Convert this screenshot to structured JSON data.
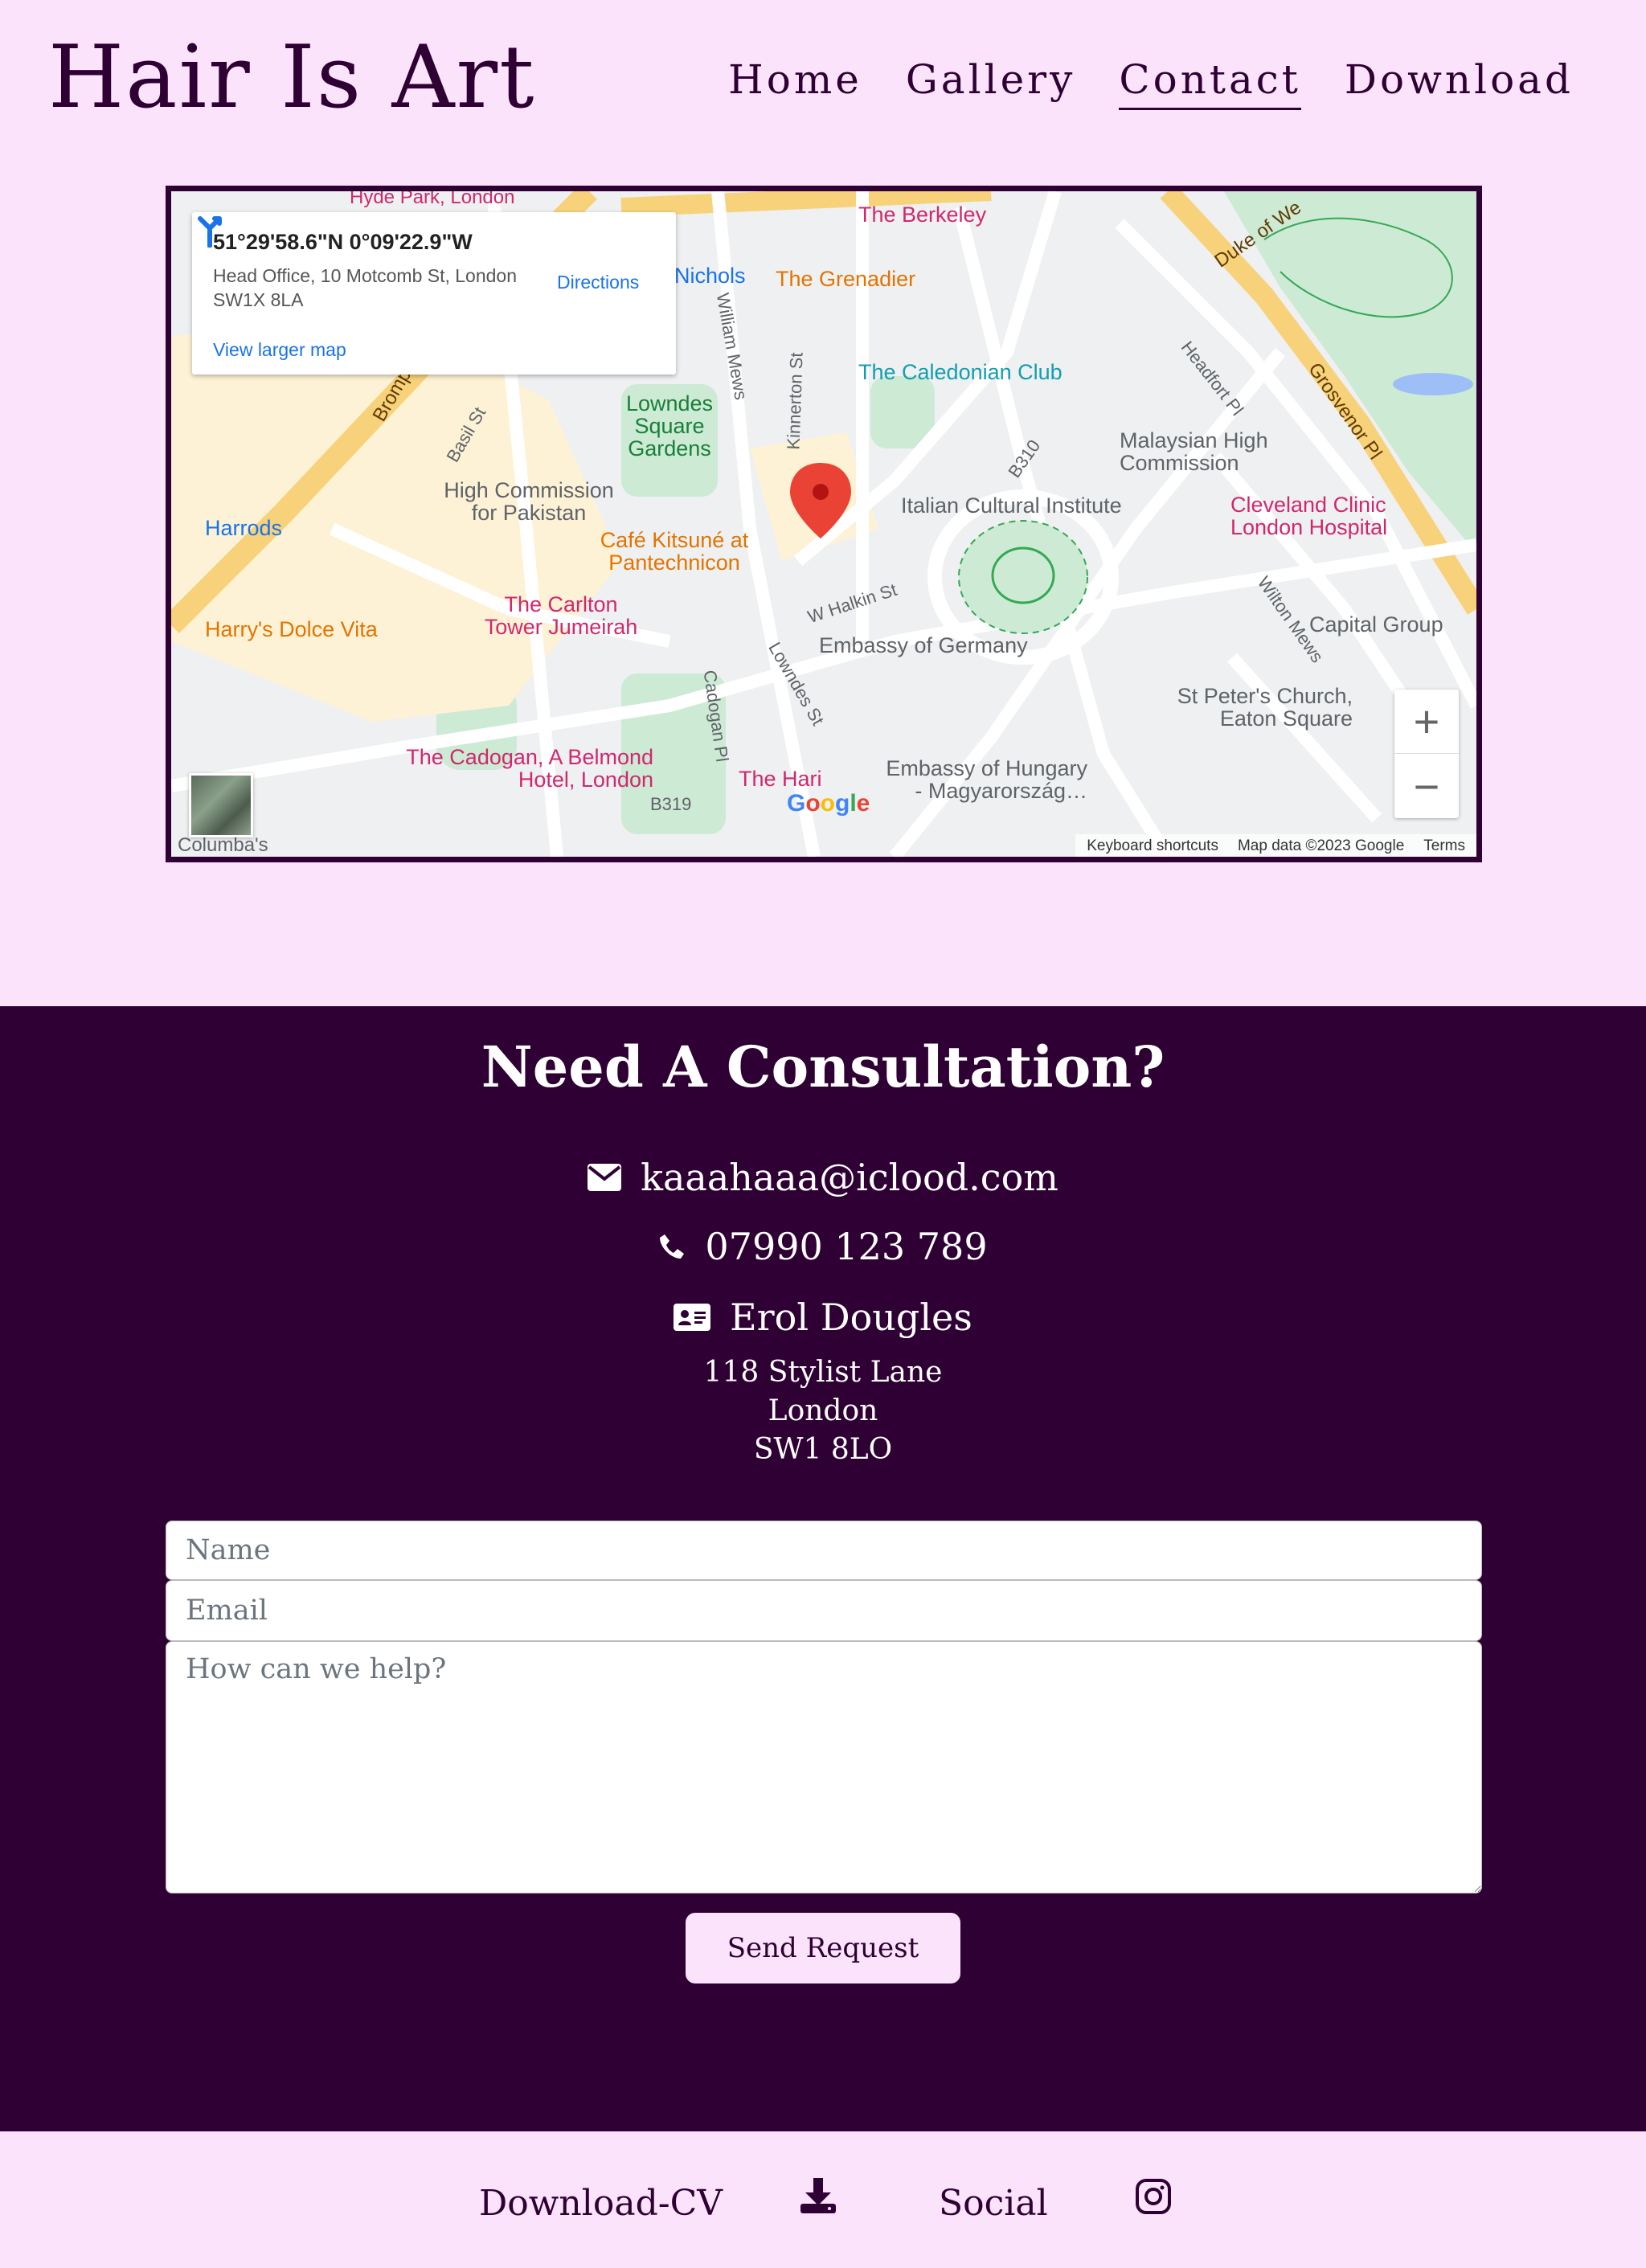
{
  "header": {
    "logo": "Hair Is Art",
    "nav": [
      {
        "label": "Home",
        "active": false
      },
      {
        "label": "Gallery",
        "active": false
      },
      {
        "label": "Contact",
        "active": true
      },
      {
        "label": "Download",
        "active": false
      }
    ]
  },
  "map": {
    "coords": "51°29'58.6\"N 0°09'22.9\"W",
    "address": "Head Office, 10 Motcomb St, London SW1X 8LA",
    "directions_label": "Directions",
    "view_larger_label": "View larger map",
    "zoom_in": "+",
    "zoom_out": "−",
    "footer": {
      "shortcuts": "Keyboard shortcuts",
      "map_data": "Map data ©2023 Google",
      "terms": "Terms"
    },
    "google_logo": "Google",
    "places": [
      "The Berkeley",
      "The Grenadier",
      "The Caledonian Club",
      "Malaysian High Commission",
      "Italian Cultural Institute",
      "Cleveland Clinic London Hospital",
      "Capital Group",
      "High Commission for Pakistan",
      "Café Kitsuné at Pantechnicon",
      "Harrods",
      "Harry's Dolce Vita",
      "The Carlton Tower Jumeirah",
      "Embassy of Germany",
      "St Peter's Church, Eaton Square",
      "The Cadogan, A Belmond Hotel, London",
      "The Hari",
      "Embassy of Hungary - Magyarország…",
      "Lowndes Square Gardens",
      "Nichols",
      "Duke of We",
      "Grosvenor Pl",
      "Headfort Pl",
      "Wilton Mews",
      "William Mews",
      "Kinnerton St",
      "Basil St",
      "W Halkin St",
      "Lowndes St",
      "Cadogan Pl",
      "B310",
      "B319",
      "Columba's",
      "Bromp",
      "Hyde Park, London"
    ]
  },
  "consult": {
    "title": "Need A Consultation?",
    "email": "kaaahaaa@iclood.com",
    "phone": "07990 123 789",
    "name": "Erol Dougles",
    "address_lines": [
      "118 Stylist Lane",
      "London",
      "SW1 8LO"
    ],
    "form": {
      "name_placeholder": "Name",
      "email_placeholder": "Email",
      "message_placeholder": "How can we help?",
      "submit_label": "Send Request"
    }
  },
  "footer": {
    "download_label": "Download-CV",
    "social_label": "Social"
  },
  "colors": {
    "background": "#fbe3fb",
    "dark": "#2e0033",
    "map_marker": "#ea4335",
    "link_blue": "#1a73e8"
  }
}
